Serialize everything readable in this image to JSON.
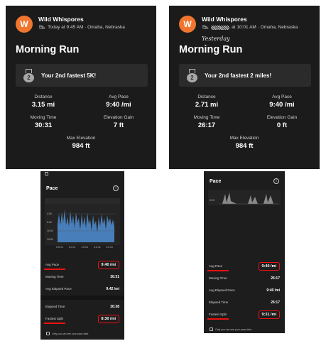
{
  "top_left": {
    "avatar_letter": "W",
    "athlete": "Wild Whispores",
    "meta": "Today at 9:45 AM · Omaha, Nebraska",
    "title": "Morning Run",
    "achievement": "Your 2nd fastest 5K!",
    "medal_rank": "2",
    "stats": [
      {
        "label": "Distance",
        "value": "3.15 mi"
      },
      {
        "label": "Avg Pace",
        "value": "9:40 /mi"
      },
      {
        "label": "Moving Time",
        "value": "30:31"
      },
      {
        "label": "Elevation Gain",
        "value": "7 ft"
      }
    ],
    "max_elevation_label": "Max Elevation",
    "max_elevation_value": "984 ft"
  },
  "top_right": {
    "avatar_letter": "W",
    "athlete": "Wild Whispores",
    "meta": "at 10:01 AM · Omaha, Nebraska",
    "handwritten_note": "Yesterday",
    "title": "Morning Run",
    "achievement": "Your 2nd fastest 2 miles!",
    "medal_rank": "2",
    "stats": [
      {
        "label": "Distance",
        "value": "2.71 mi"
      },
      {
        "label": "Avg Pace",
        "value": "9:40 /mi"
      },
      {
        "label": "Moving Time",
        "value": "26:17"
      },
      {
        "label": "Elevation Gain",
        "value": "0 ft"
      }
    ],
    "max_elevation_label": "Max Elevation",
    "max_elevation_value": "984 ft"
  },
  "bottom_left": {
    "pace_title": "Pace",
    "y_ticks": [
      "4:00",
      "6:00",
      "10:00",
      "13:00"
    ],
    "x_ticks": [
      "0.5 mi",
      "1.0 mi",
      "1.5 mi",
      "2.0 mi",
      "2.5 mi"
    ],
    "rows": [
      {
        "label": "Avg Pace",
        "value": "9:40 /mi",
        "highlight": true
      },
      {
        "label": "Moving Time",
        "value": "30:31",
        "highlight": false
      },
      {
        "label": "Avg Elapsed Pace",
        "value": "9:42 /mi",
        "highlight": false
      },
      {
        "label": "Elapsed Time",
        "value": "30:38",
        "highlight": false
      },
      {
        "label": "Fastest Split",
        "value": "8:30 /mi",
        "highlight": true
      }
    ],
    "private_note": "Only you can see your pace data."
  },
  "bottom_right": {
    "pace_title": "Pace",
    "y_ticks": [
      "9:00"
    ],
    "rows": [
      {
        "label": "Avg Pace",
        "value": "9:40 /mi",
        "highlight": true
      },
      {
        "label": "Moving Time",
        "value": "26:17",
        "highlight": false
      },
      {
        "label": "Avg Elapsed Pace",
        "value": "9:40 /mi",
        "highlight": false
      },
      {
        "label": "Elapsed Time",
        "value": "26:17",
        "highlight": false
      },
      {
        "label": "Fastest Split",
        "value": "9:31 /mi",
        "highlight": true
      }
    ],
    "private_note": "Only you can see your pace data."
  },
  "colors": {
    "card_bg": "#1b1b1b",
    "avatar_orange": "#f0762f",
    "pace_blue": "#4f8fd6",
    "highlight_red": "#e11111"
  }
}
